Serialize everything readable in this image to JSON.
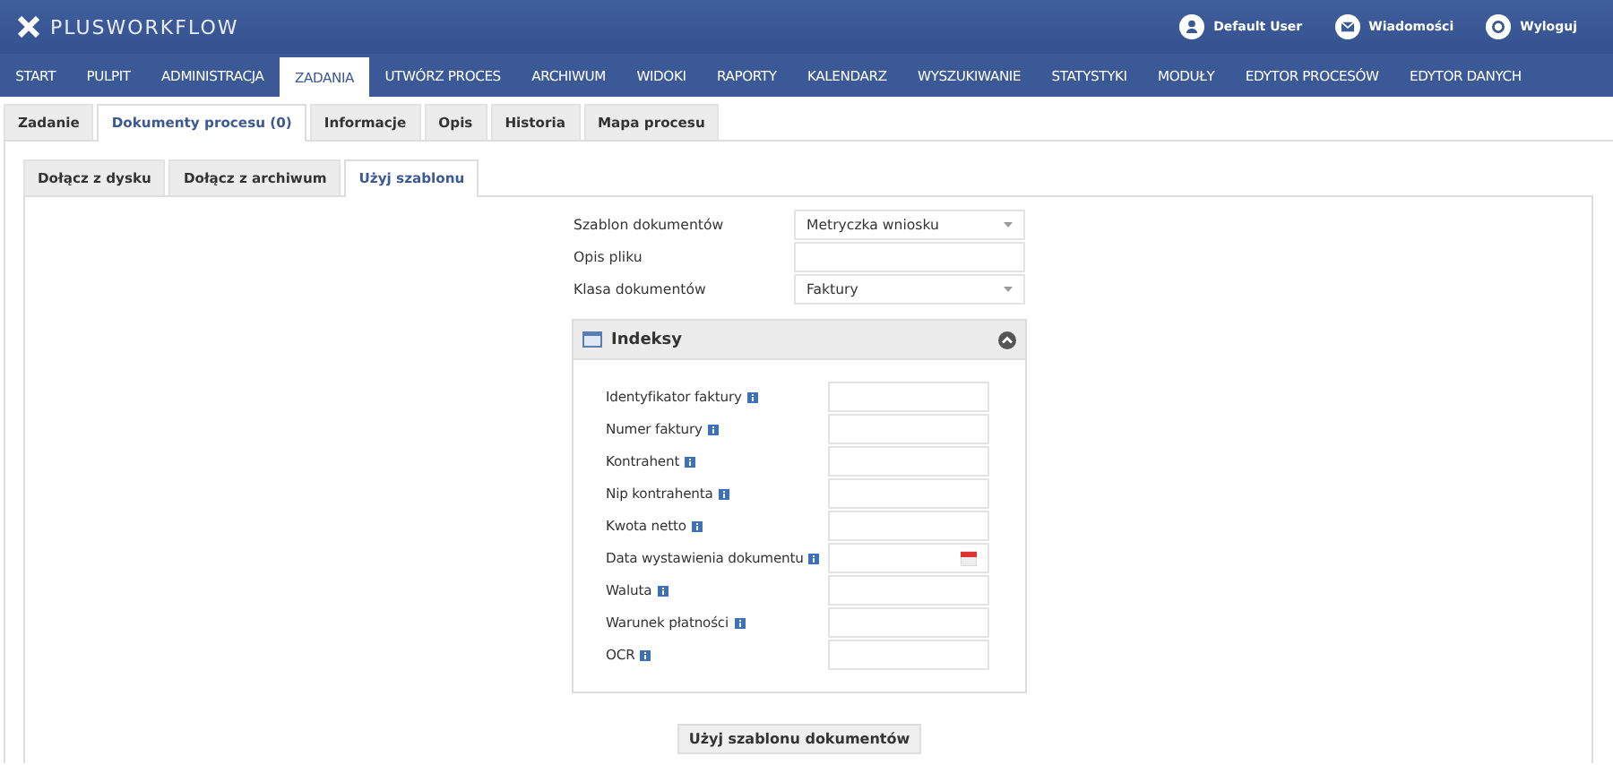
{
  "header": {
    "logo": "PLUSWORKFLOW",
    "actions": [
      {
        "kind": "user",
        "label": "Default User"
      },
      {
        "kind": "mail",
        "label": "Wiadomości"
      },
      {
        "kind": "power",
        "label": "Wyloguj"
      }
    ]
  },
  "menu": [
    {
      "label": "START",
      "selected": false
    },
    {
      "label": "PULPIT",
      "selected": false
    },
    {
      "label": "ADMINISTRACJA",
      "selected": false
    },
    {
      "label": "ZADANIA",
      "selected": true
    },
    {
      "label": "UTWÓRZ PROCES",
      "selected": false
    },
    {
      "label": "ARCHIWUM",
      "selected": false
    },
    {
      "label": "WIDOKI",
      "selected": false
    },
    {
      "label": "RAPORTY",
      "selected": false
    },
    {
      "label": "KALENDARZ",
      "selected": false
    },
    {
      "label": "WYSZUKIWANIE",
      "selected": false
    },
    {
      "label": "STATYSTYKI",
      "selected": false
    },
    {
      "label": "MODUŁY",
      "selected": false
    },
    {
      "label": "EDYTOR PROCESÓW",
      "selected": false
    },
    {
      "label": "EDYTOR DANYCH",
      "selected": false
    }
  ],
  "task_tabs": [
    {
      "label": "Zadanie",
      "selected": false
    },
    {
      "label": "Dokumenty procesu (0)",
      "selected": true
    },
    {
      "label": "Informacje",
      "selected": false
    },
    {
      "label": "Opis",
      "selected": false
    },
    {
      "label": "Historia",
      "selected": false
    },
    {
      "label": "Mapa procesu",
      "selected": false
    }
  ],
  "source_tabs": [
    {
      "label": "Dołącz z dysku",
      "selected": false
    },
    {
      "label": "Dołącz z archiwum",
      "selected": false
    },
    {
      "label": "Użyj szablonu",
      "selected": true
    }
  ],
  "form": [
    {
      "label": "Szablon dokumentów",
      "kind": "select",
      "value": "Metryczka wniosku"
    },
    {
      "label": "Opis pliku",
      "kind": "text"
    },
    {
      "label": "Klasa dokumentów",
      "kind": "select",
      "value": "Faktury"
    }
  ],
  "indexes": {
    "title": "Indeksy",
    "expanded": true,
    "fields": [
      {
        "label": "Identyfikator faktury",
        "kind": "text"
      },
      {
        "label": "Numer faktury",
        "kind": "text"
      },
      {
        "label": "Kontrahent",
        "kind": "text"
      },
      {
        "label": "Nip kontrahenta",
        "kind": "text"
      },
      {
        "label": "Kwota netto",
        "kind": "text"
      },
      {
        "label": "Data wystawienia dokumentu",
        "kind": "date"
      },
      {
        "label": "Waluta",
        "kind": "text"
      },
      {
        "label": "Warunek płatności",
        "kind": "text"
      },
      {
        "label": "OCR",
        "kind": "text"
      }
    ]
  },
  "submit_button": "Użyj szablonu dokumentów"
}
